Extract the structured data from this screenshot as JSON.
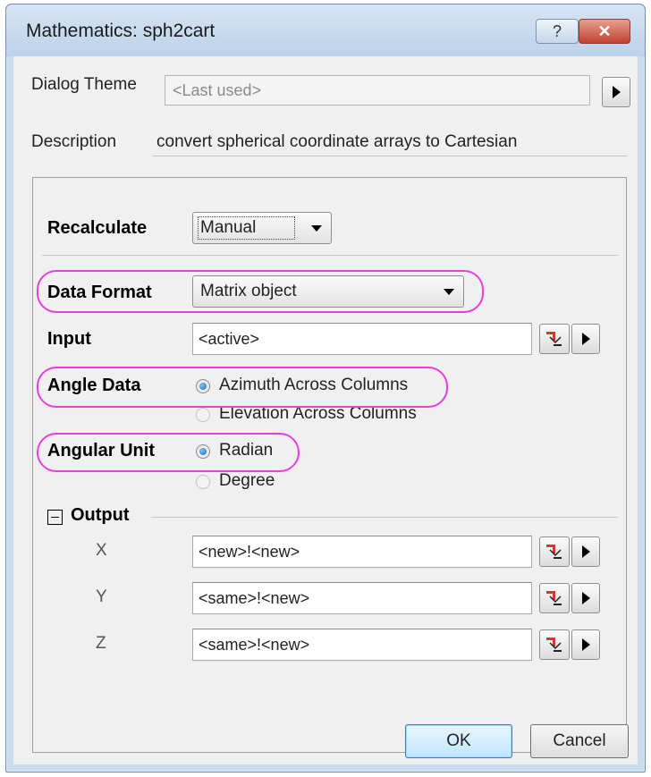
{
  "window": {
    "title": "Mathematics: sph2cart",
    "help_glyph": "?",
    "close_glyph": "✕"
  },
  "dialog_theme": {
    "label": "Dialog Theme",
    "value": "<Last used>"
  },
  "description": {
    "label": "Description",
    "text": "convert spherical coordinate arrays to Cartesian"
  },
  "recalculate": {
    "label": "Recalculate",
    "value": "Manual"
  },
  "data_format": {
    "label": "Data Format",
    "value": "Matrix object"
  },
  "input": {
    "label": "Input",
    "value": "<active>"
  },
  "angle_data": {
    "label": "Angle Data",
    "options": [
      "Azimuth Across Columns",
      "Elevation Across Columns"
    ],
    "selected": "Azimuth Across Columns"
  },
  "angular_unit": {
    "label": "Angular Unit",
    "options": [
      "Radian",
      "Degree"
    ],
    "selected": "Radian"
  },
  "output": {
    "label": "Output",
    "rows": [
      {
        "label": "X",
        "value": "<new>!<new>"
      },
      {
        "label": "Y",
        "value": "<same>!<new>"
      },
      {
        "label": "Z",
        "value": "<same>!<new>"
      }
    ]
  },
  "buttons": {
    "ok": "OK",
    "cancel": "Cancel"
  },
  "colors": {
    "highlight": "#e83ee0",
    "title_bar": "#c9dbee"
  },
  "icons": [
    "help-icon",
    "close-icon",
    "expand-arrow-icon",
    "dropdown-arrow-icon",
    "range-select-icon",
    "collapse-icon"
  ]
}
